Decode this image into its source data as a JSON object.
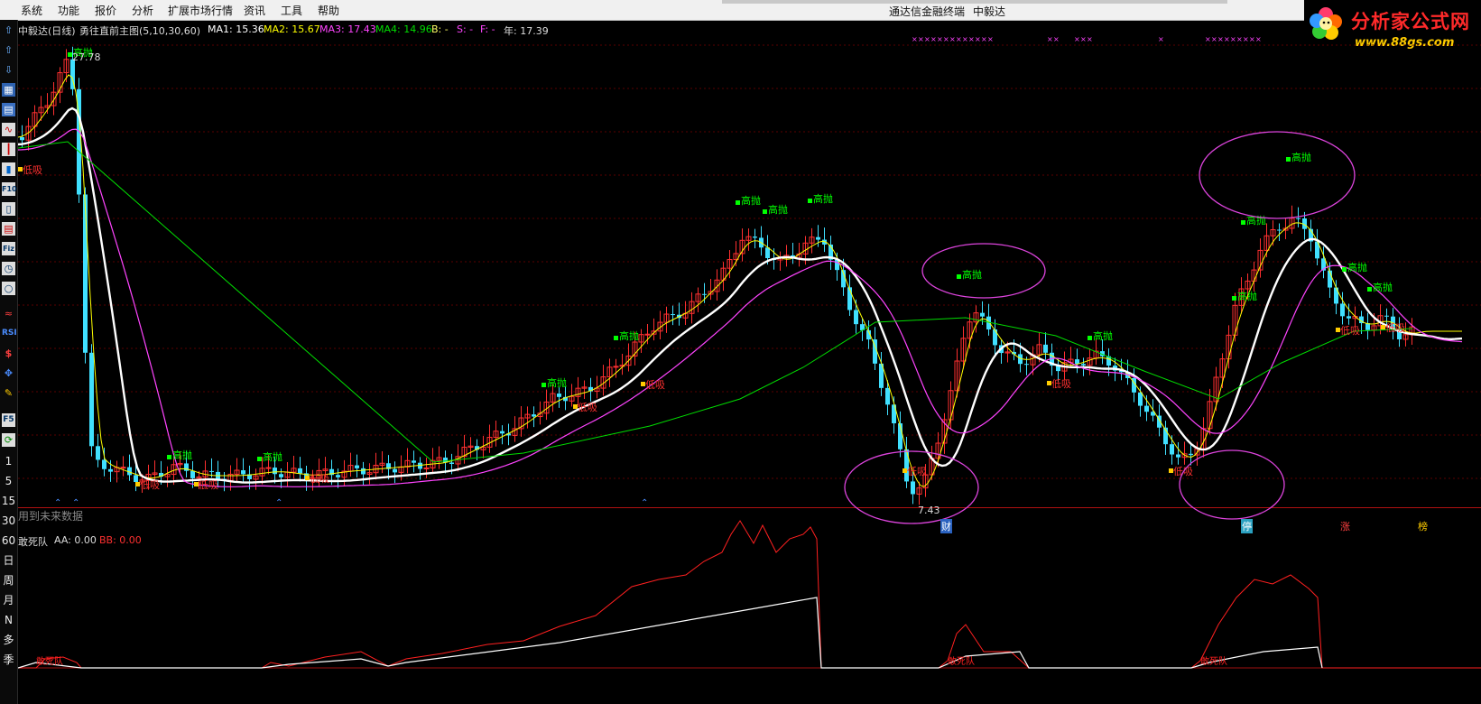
{
  "menu": {
    "items": [
      "系统",
      "功能",
      "报价",
      "分析",
      "扩展市场行情",
      "资讯",
      "工具",
      "帮助"
    ],
    "window_title": "通达信金融终端",
    "stock_name": "中毅达"
  },
  "logo": {
    "text": "分析家公式网",
    "url": "www.88gs.com"
  },
  "main_header": {
    "stock_label": "中毅达(日线)",
    "formula": "勇往直前主图(5,10,30,60)",
    "ma1": "MA1: 15.36",
    "ma2": "MA2: 15.67",
    "ma3": "MA3: 17.43",
    "ma4": "MA4: 14.96",
    "b": "B: -",
    "s": "S: -",
    "f": "F: -",
    "year": "年: 17.39"
  },
  "annotations": {
    "high_price": "27.78",
    "low_price": "7.43",
    "future_data": "用到未来数据",
    "high_sell": "高抛",
    "low_buy": "低吸",
    "bottom_badges": [
      "财",
      "停",
      "涨",
      "榜"
    ]
  },
  "sub_header": {
    "name": "敢死队",
    "aa": "AA: 0.00",
    "bb": "BB: 0.00",
    "indicator_label": "敢死队"
  },
  "toolbar": {
    "icons": [
      "up-arrow-icon",
      "up-arrow-icon",
      "down-arrow-icon",
      "chart-icon",
      "grid-icon",
      "line-chart-icon",
      "kline-icon",
      "bar-icon",
      "f10-icon",
      "doc-icon",
      "list-icon",
      "fiz-icon",
      "time-icon",
      "circle-icon",
      "wave-icon",
      "rsi-icon",
      "dollar-icon",
      "move-icon",
      "pencil-icon",
      "f5-icon",
      "refresh-icon"
    ],
    "labels": [
      "RSI",
      "F10",
      "Fiz",
      "F5"
    ],
    "periods": [
      "1",
      "5",
      "15",
      "30",
      "60",
      "日",
      "周",
      "月",
      "N",
      "多",
      "季"
    ]
  },
  "colors": {
    "ma1": "#ffffff",
    "ma2": "#ffff00",
    "ma3": "#ff44ff",
    "ma4": "#00dd00",
    "up": "#ff3030",
    "down": "#40e0ff",
    "high_sell": "#00ff00",
    "low_buy": "#ff3030",
    "ellipse": "#dd44dd"
  },
  "chart_data": {
    "type": "candlestick",
    "price_range": [
      7.43,
      27.78
    ],
    "ma_legend": [
      "MA1",
      "MA2",
      "MA3",
      "MA4"
    ],
    "ma_values": [
      15.36,
      15.67,
      17.43,
      14.96
    ],
    "sub_indicator": {
      "name": "敢死队",
      "series": [
        "AA",
        "BB"
      ],
      "values": [
        0.0,
        0.0
      ]
    }
  }
}
